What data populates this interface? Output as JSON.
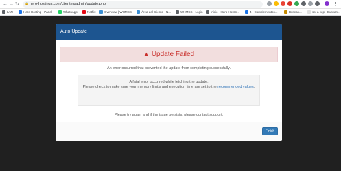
{
  "browser": {
    "url": "hero-hostings.com/clientes/admin/update.php",
    "bookmarks": [
      {
        "label": "LAN",
        "color": "#5f6368"
      },
      {
        "label": "Hero Hosting - Panel",
        "color": "#1a73e8"
      },
      {
        "label": "WhatsApp",
        "color": "#25d366"
      },
      {
        "label": "Netflix",
        "color": "#e50914"
      },
      {
        "label": "Overview | WHMCS",
        "color": "#3b8fd4"
      },
      {
        "label": "Área del Cliente - N...",
        "color": "#3b8fd4"
      },
      {
        "label": "WHMCS - Login",
        "color": "#5f6368"
      },
      {
        "label": "Inicio - Hero Hostin...",
        "color": "#5f6368"
      },
      {
        "label": "4 - Complementos...",
        "color": "#1a73e8"
      },
      {
        "label": "Buscan...",
        "color": "#c58a00"
      },
      {
        "label": "sol a cep - Buscan...",
        "color": "#e0e0e0"
      }
    ]
  },
  "modal": {
    "title": "Auto Update",
    "failed_heading": "Update Failed",
    "intro": "An error occurred that prevented the update from completing successfully.",
    "error_line1": "A fatal error occurred while fetching the update.",
    "error_line2_prefix": "Please check to make sure your memory limits and execution time are set to the ",
    "error_link": "recommended values",
    "error_line2_suffix": ".",
    "retry_text": "Please try again and if the issue persists, please contact support.",
    "finish_label": "Finish"
  },
  "colors": {
    "header": "#1d5590",
    "danger": "#c9302c",
    "danger_bg": "#f2dede",
    "primary": "#337ab7"
  }
}
